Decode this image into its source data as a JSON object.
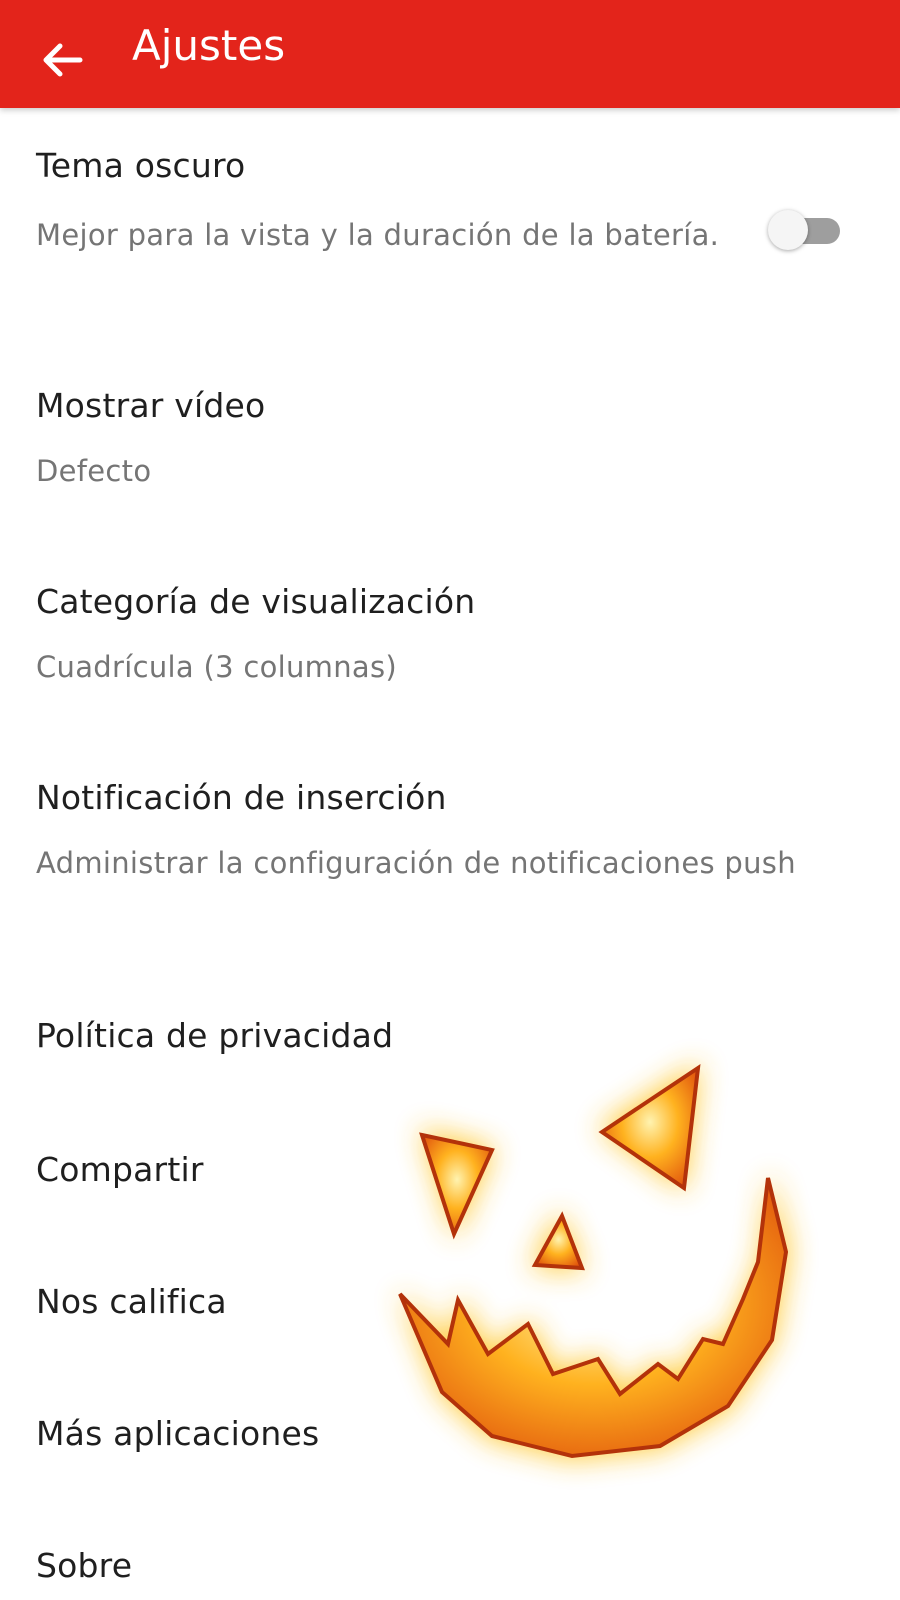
{
  "appbar": {
    "title": "Ajustes",
    "back_icon": "arrow-left-icon",
    "color": "#e3241b"
  },
  "settings": {
    "dark_theme": {
      "title": "Tema oscuro",
      "summary": "Mejor para la vista y la duración de la batería.",
      "enabled": false
    },
    "video": {
      "title": "Mostrar vídeo",
      "summary": "Defecto"
    },
    "view_category": {
      "title": "Categoría de visualización",
      "summary": "Cuadrícula (3 columnas)"
    },
    "push": {
      "title": "Notificación de inserción",
      "summary": "Administrar la configuración de notificaciones push"
    },
    "privacy": {
      "title": "Política de privacidad"
    },
    "share": {
      "title": "Compartir"
    },
    "rate": {
      "title": "Nos califica"
    },
    "more_apps": {
      "title": "Más aplicaciones"
    },
    "about": {
      "title": "Sobre"
    }
  },
  "overlay": {
    "icon": "jack-o-lantern-face-icon"
  }
}
